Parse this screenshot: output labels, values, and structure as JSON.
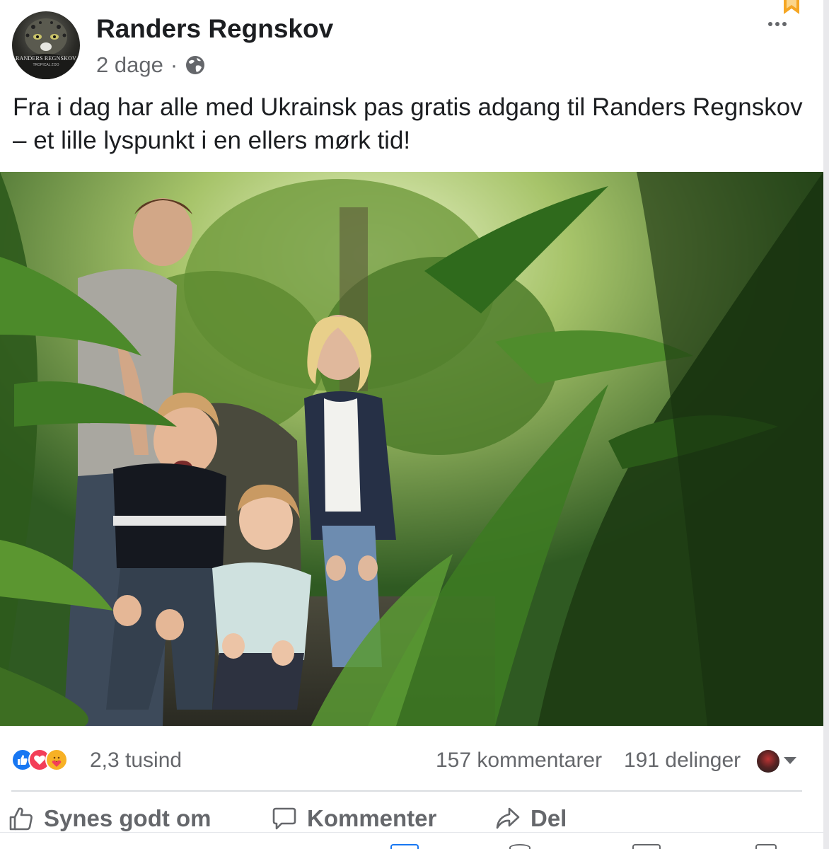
{
  "post": {
    "page_name": "Randers Regnskov",
    "avatar_text": "RANDERS REGNSKOV",
    "avatar_subtext": "TROPICAL ZOO",
    "time": "2 dage",
    "separator": "·",
    "privacy_icon": "globe-icon",
    "text": "Fra i dag har alle med Ukrainsk pas gratis adgang til Randers Regnskov – et lille lyspunkt i en ellers mørk tid!",
    "more_icon": "more-dots-icon"
  },
  "stats": {
    "reaction_icons": [
      "like-icon",
      "love-icon",
      "care-icon"
    ],
    "reaction_count": "2,3 tusind",
    "comments": "157 kommentarer",
    "shares": "191 delinger"
  },
  "actions": {
    "like": "Synes godt om",
    "comment": "Kommenter",
    "share": "Del"
  },
  "colors": {
    "like_blue": "#1877f2",
    "love_red": "#f33e58",
    "care_yellow": "#f7b125",
    "secondary_text": "#65676b",
    "bookmark_orange": "#f5a623"
  }
}
